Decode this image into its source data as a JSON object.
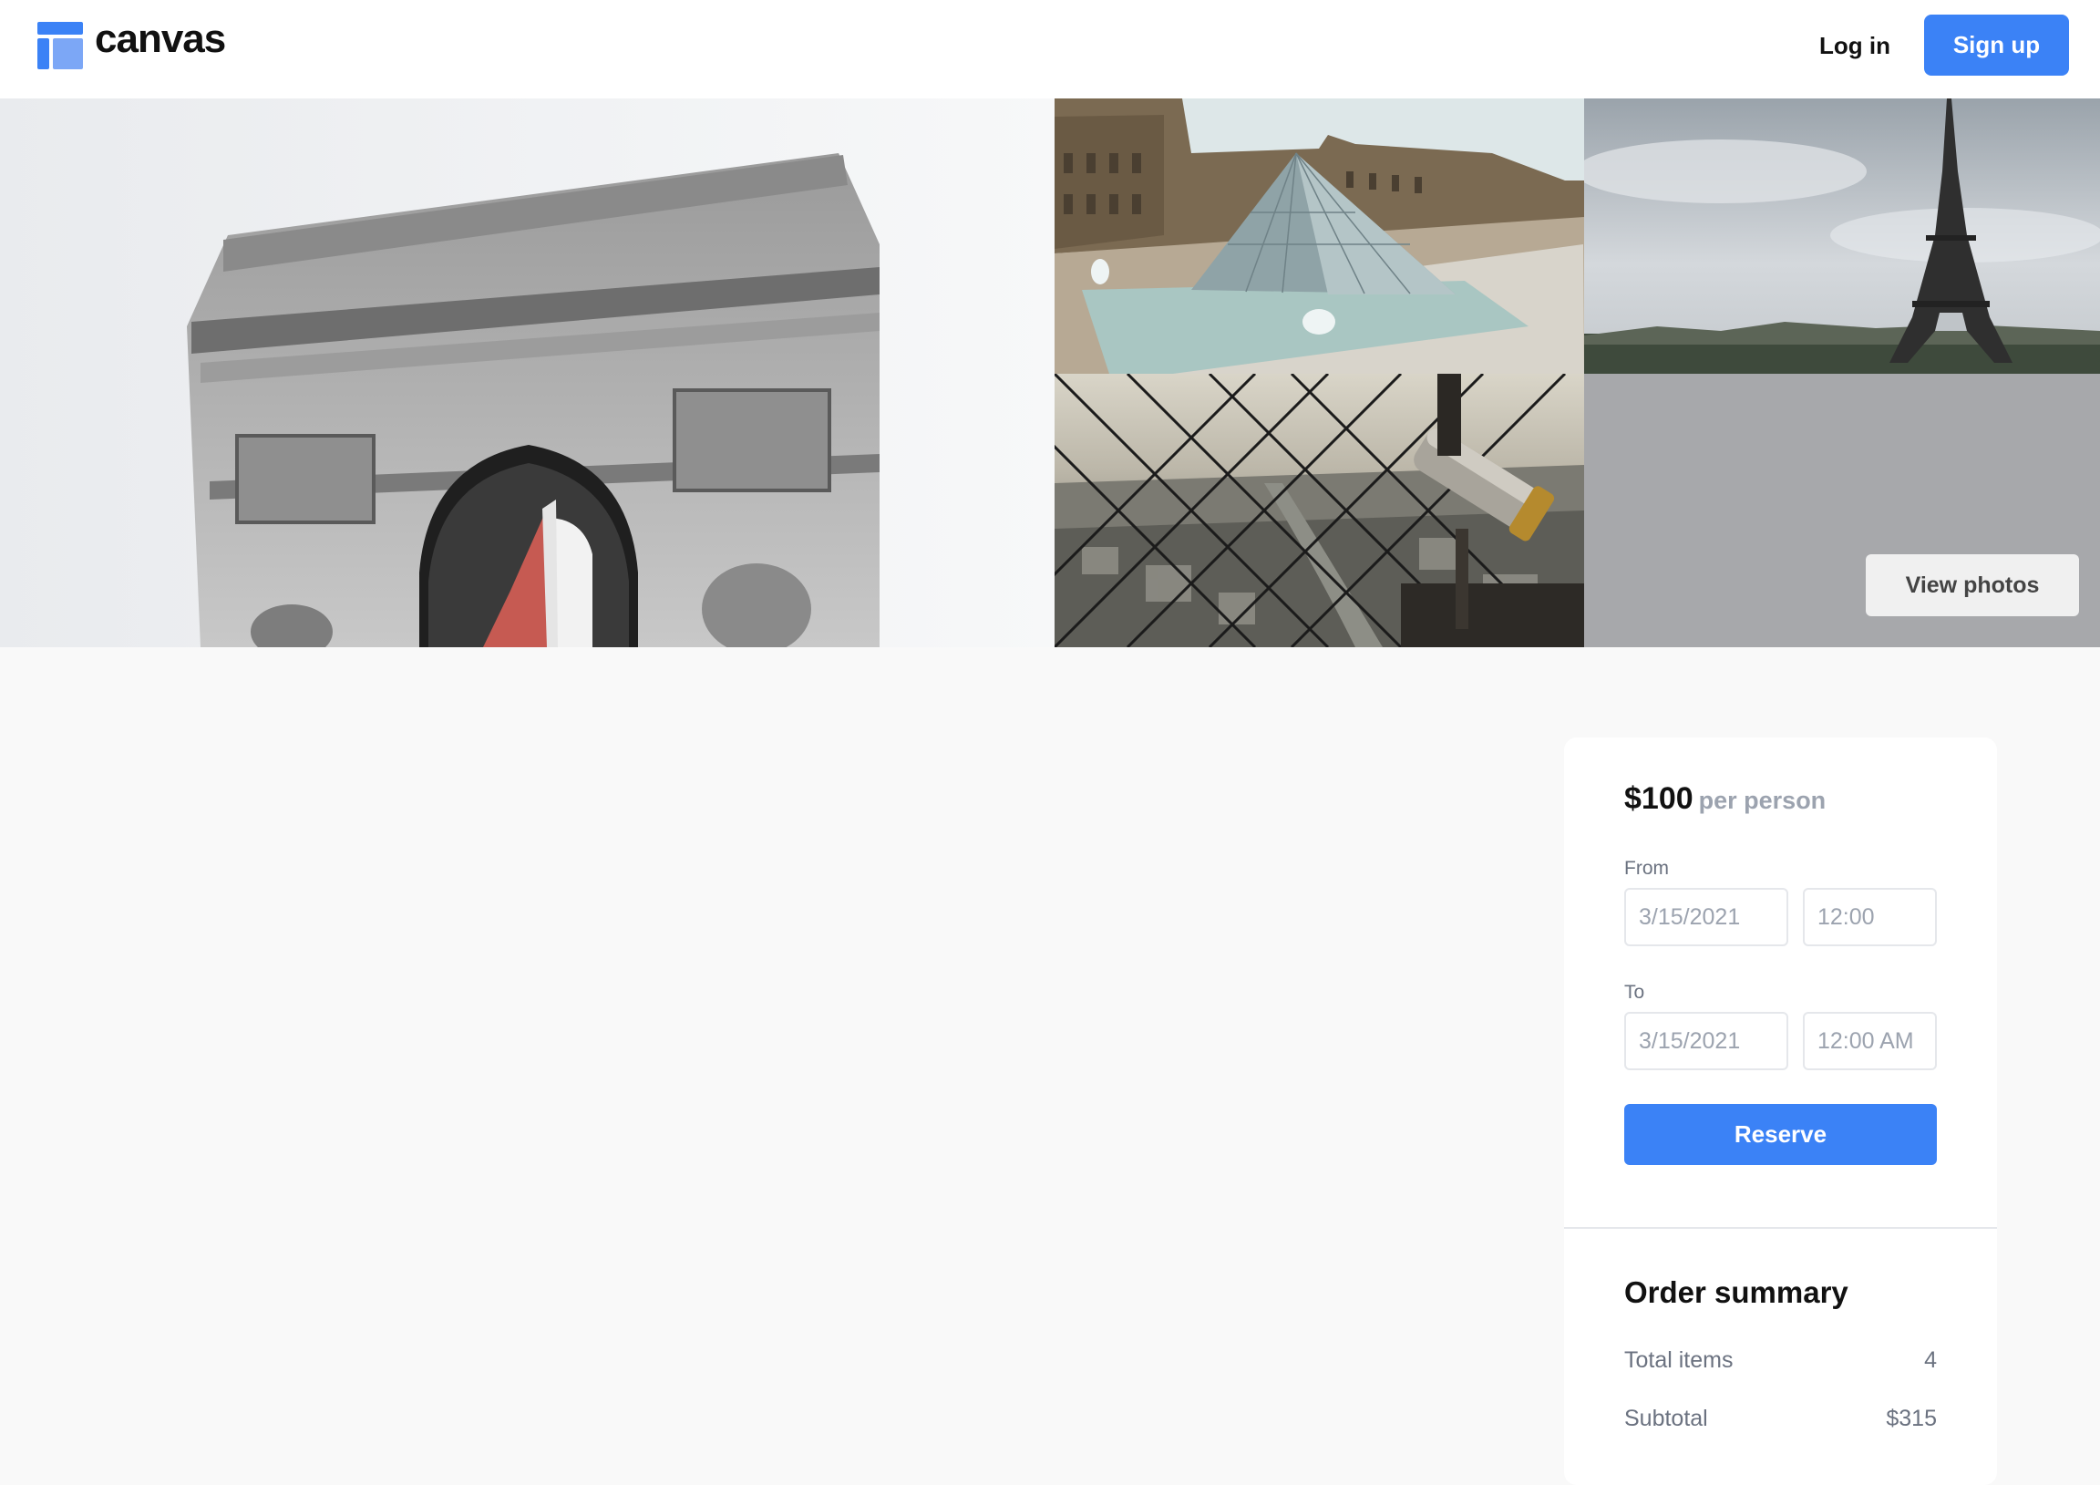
{
  "header": {
    "brand": "canvas",
    "login_label": "Log in",
    "signup_label": "Sign up",
    "accent_color": "#3b82f6"
  },
  "gallery": {
    "view_photos_label": "View photos"
  },
  "booking": {
    "price": "$100",
    "price_unit": "per person",
    "from_label": "From",
    "from_date": "3/15/2021",
    "from_time": "12:00",
    "to_label": "To",
    "to_date": "3/15/2021",
    "to_time": "12:00 AM",
    "reserve_label": "Reserve"
  },
  "summary": {
    "title": "Order summary",
    "rows": [
      {
        "label": "Total items",
        "value": "4"
      },
      {
        "label": "Subtotal",
        "value": "$315"
      }
    ]
  }
}
